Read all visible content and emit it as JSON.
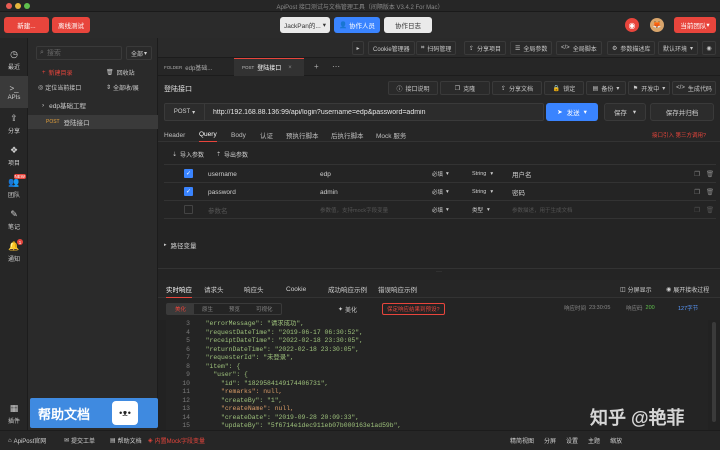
{
  "window": {
    "title": "ApiPost 接口测试与文档管理工具（间隔版本 V3.4.2 For Mac）"
  },
  "topbar": {
    "new_label": "新建...",
    "offline_label": "离线测试",
    "workspace": "JackPan的...",
    "invite": "协作人员",
    "log": "协作日志",
    "team": "当前团队"
  },
  "nav": [
    {
      "label": "最近"
    },
    {
      "label": "APIs"
    },
    {
      "label": "分享"
    },
    {
      "label": "项目"
    },
    {
      "label": "团队",
      "badge": "NEW"
    },
    {
      "label": "笔记"
    },
    {
      "label": "通知",
      "badge": "1"
    },
    {
      "label": "插件"
    }
  ],
  "sidebar": {
    "search_placeholder": "搜索",
    "filter": "全部",
    "new_dir": "新建目录",
    "recycle": "回收站",
    "locate": "定位当前接口",
    "collapse": "全部收/展",
    "folder": "edp基础工程",
    "api_method": "POST",
    "api_name": "登陆接口"
  },
  "toolbar": [
    "Cookie管理器",
    "扫码管理",
    "分享项目",
    "全局参数",
    "全局脚本",
    "参数描述库",
    "默认环境"
  ],
  "tabs": [
    {
      "prefix": "FOLDER",
      "label": "edp基础..."
    },
    {
      "prefix": "POST",
      "label": "登陆接口"
    }
  ],
  "api": {
    "title": "登陆接口",
    "actions": [
      "接口说明",
      "克隆",
      "分享文档",
      "锁定",
      "备份",
      "开发中",
      "生成代码"
    ],
    "method": "POST",
    "url": "http://192.168.88.136:99/api/login?username=edp&password=admin",
    "send": "发送",
    "save": "保存",
    "save_share": "保存并归档"
  },
  "req_tabs": [
    "Header",
    "Query",
    "Body",
    "认证",
    "预执行脚本",
    "后执行脚本",
    "Mock 服务"
  ],
  "req_tab_note": "接口引入 第三方调用?",
  "query": {
    "import": "导入参数",
    "export": "导出参数",
    "rows": [
      {
        "key": "username",
        "value": "edp",
        "req": "必填",
        "type": "String",
        "desc": "用户名"
      },
      {
        "key": "password",
        "value": "admin",
        "req": "必填",
        "type": "String",
        "desc": "密码"
      },
      {
        "key": "参数名",
        "value": "参数值，支持mock字段变量",
        "req": "必填",
        "type": "类型",
        "desc": "参数描述，用于生成文档"
      }
    ]
  },
  "path_vars": "路径变量",
  "resp_tabs": [
    "实时响应",
    "请求头",
    "响应头",
    "Cookie",
    "成功响应示例",
    "错误响应示例"
  ],
  "resp_actions": [
    "分屏显示",
    "展开接收过程"
  ],
  "resp_view": {
    "modes": [
      "美化",
      "原生",
      "预览",
      "可视化"
    ],
    "beautify": "美化",
    "hint": "保定响应结果到预设?",
    "time_label": "响应时间",
    "time_val": "23:30:05",
    "size_label": "响应码",
    "size_val": "200",
    "bytes": "127字节"
  },
  "code": [
    {
      "n": "3",
      "t": "  \"errorMessage\": \"请求成功\","
    },
    {
      "n": "4",
      "t": "  \"requestDateTime\": \"2019-06-17 06:30:52\","
    },
    {
      "n": "5",
      "t": "  \"receiptDateTime\": \"2022-02-18 23:30:05\","
    },
    {
      "n": "6",
      "t": "  \"returnDateTime\": \"2022-02-18 23:30:05\","
    },
    {
      "n": "7",
      "t": "  \"requesterId\": \"未登录\","
    },
    {
      "n": "8",
      "t": "  \"item\": {"
    },
    {
      "n": "9",
      "t": "    \"user\": {"
    },
    {
      "n": "10",
      "t": "      \"id\": \"1829584149174406731\","
    },
    {
      "n": "11",
      "t": "      \"remarks\": null,"
    },
    {
      "n": "12",
      "t": "      \"createBy\": \"1\","
    },
    {
      "n": "13",
      "t": "      \"createName\": null,"
    },
    {
      "n": "14",
      "t": "      \"createDate\": \"2019-09-28 20:09:33\","
    },
    {
      "n": "15",
      "t": "      \"updateBy\": \"5f6714e1dec911eb07b000163e1ad59b\","
    },
    {
      "n": "16",
      "t": "      \"updateName\": null,"
    }
  ],
  "bottombar": [
    "ApiPost官网",
    "提交工单",
    "帮助文档",
    "内置Mock字段变量"
  ],
  "bottom_right": [
    "精简视图",
    "分屏",
    "设置",
    "主题",
    "缩放"
  ],
  "help": "帮助文档",
  "watermark": "知乎 @艳菲",
  "accent": "#e8453c",
  "blue": "#3a84ff"
}
